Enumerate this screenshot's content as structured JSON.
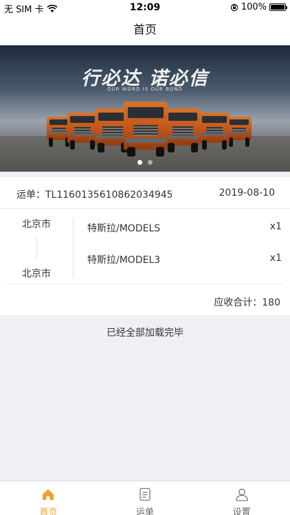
{
  "status_bar": {
    "carrier": "无 SIM 卡",
    "time": "12:09",
    "battery": "100%"
  },
  "nav": {
    "title": "首页"
  },
  "banner": {
    "slogan": "行必达 诺必信",
    "subtitle": "OUR WORD IS OUR BOND",
    "slide_count": 2,
    "active_slide": 1
  },
  "order": {
    "number_label": "运单：TL1160135610862034945",
    "date": "2019-08-10",
    "from": "北京市",
    "to": "北京市",
    "goods": [
      {
        "name": "特斯拉/MODELS",
        "qty": "x1"
      },
      {
        "name": "特斯拉/MODEL3",
        "qty": "x1"
      }
    ],
    "total_label": "应收合计：180"
  },
  "list_footer": "已经全部加载完毕",
  "tabs": [
    {
      "label": "首页",
      "icon": "home-icon",
      "active": true
    },
    {
      "label": "运单",
      "icon": "document-icon",
      "active": false
    },
    {
      "label": "设置",
      "icon": "user-icon",
      "active": false
    }
  ],
  "colors": {
    "accent": "#f0a030",
    "background": "#efeff4",
    "truck": "#d9742a"
  }
}
